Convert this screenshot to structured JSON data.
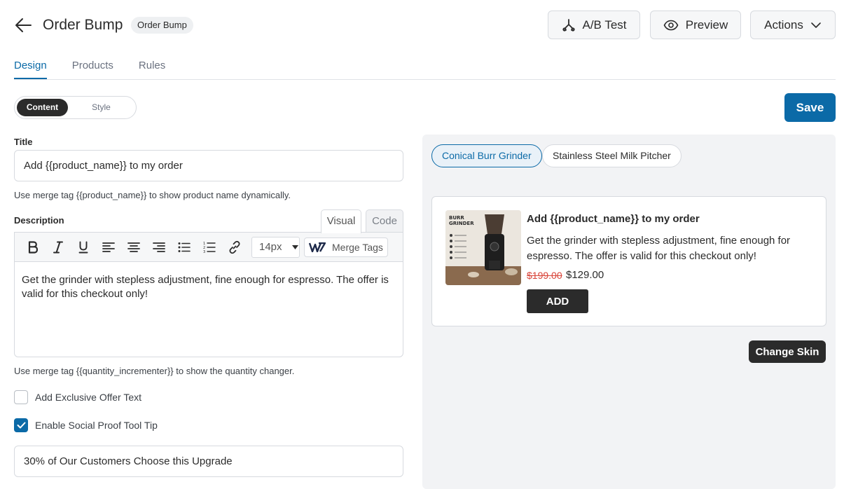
{
  "header": {
    "title": "Order Bump",
    "badge": "Order Bump",
    "ab_test_label": "A/B Test",
    "preview_label": "Preview",
    "actions_label": "Actions"
  },
  "tabs": [
    {
      "label": "Design",
      "active": true
    },
    {
      "label": "Products",
      "active": false
    },
    {
      "label": "Rules",
      "active": false
    }
  ],
  "segmented": {
    "content_label": "Content",
    "style_label": "Style",
    "selected": "Content"
  },
  "save_label": "Save",
  "form": {
    "title_label": "Title",
    "title_value": "Add {{product_name}} to my order",
    "title_hint": "Use merge tag {{product_name}} to show product name dynamically.",
    "description_label": "Description",
    "editor_tabs": {
      "visual": "Visual",
      "code": "Code"
    },
    "font_size": "14px",
    "merge_tags_label": "Merge Tags",
    "description_text": "Get the grinder with stepless adjustment, fine enough for espresso. The offer is valid for this checkout only!",
    "quantity_hint": "Use merge tag {{quantity_incrementer}} to show the quantity changer.",
    "exclusive_offer_label": "Add Exclusive Offer Text",
    "exclusive_offer_checked": false,
    "social_proof_label": "Enable Social Proof Tool Tip",
    "social_proof_checked": true,
    "social_proof_value": "30% of Our Customers Choose this Upgrade"
  },
  "preview": {
    "products": [
      {
        "label": "Conical Burr Grinder",
        "active": true
      },
      {
        "label": "Stainless Steel Milk Pitcher",
        "active": false
      }
    ],
    "card": {
      "image_text_line1": "BURR",
      "image_text_line2": "GRINDER",
      "title": "Add {{product_name}} to my order",
      "description": "Get the grinder with stepless adjustment, fine enough for espresso. The offer is valid for this checkout only!",
      "old_price": "$199.00",
      "new_price": "$129.00",
      "add_label": "ADD"
    },
    "change_skin_label": "Change Skin"
  },
  "colors": {
    "accent": "#0b6aa7",
    "dark": "#2b2b2b",
    "strike_price": "#d9453a"
  }
}
